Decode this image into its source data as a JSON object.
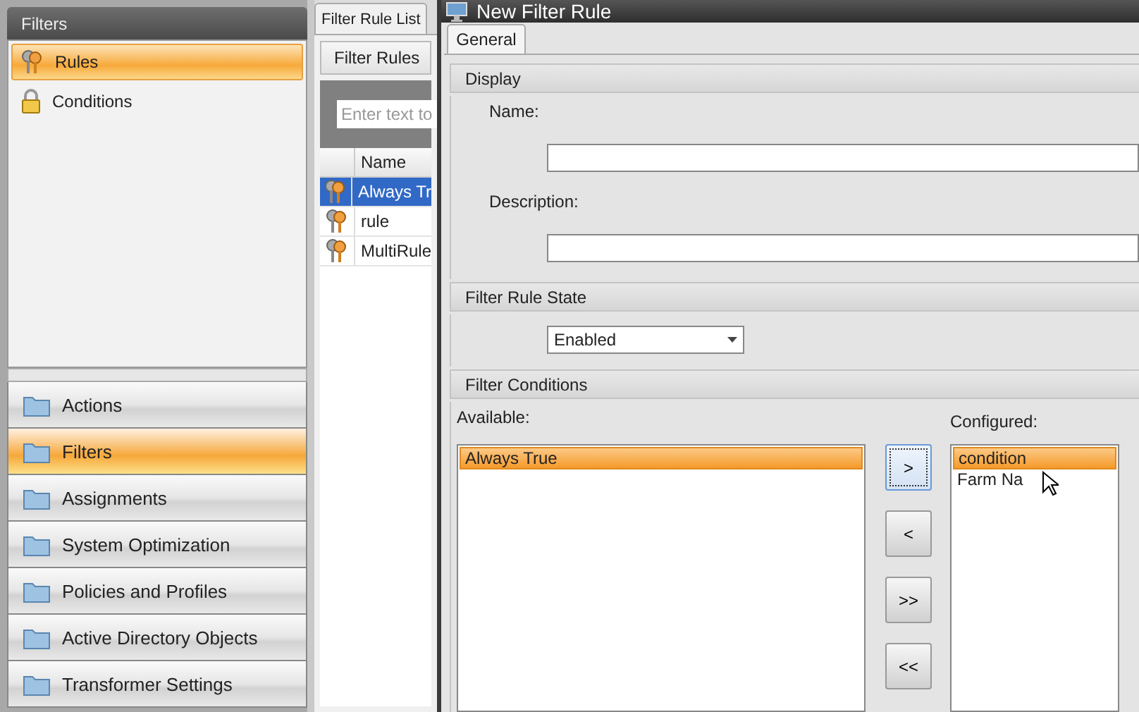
{
  "left_panel": {
    "title": "Filters",
    "items": [
      {
        "label": "Rules",
        "kind": "rule",
        "selected": true
      },
      {
        "label": "Conditions",
        "kind": "condition",
        "selected": false
      }
    ]
  },
  "navigation": [
    {
      "label": "Actions",
      "selected": false
    },
    {
      "label": "Filters",
      "selected": true
    },
    {
      "label": "Assignments",
      "selected": false
    },
    {
      "label": "System Optimization",
      "selected": false
    },
    {
      "label": "Policies and Profiles",
      "selected": false
    },
    {
      "label": "Active Directory Objects",
      "selected": false
    },
    {
      "label": "Transformer Settings",
      "selected": false
    }
  ],
  "middle": {
    "tab": "Filter Rule List",
    "subtab": "Filter Rules",
    "search": {
      "placeholder": "Enter text to"
    },
    "column": "Name",
    "rows": [
      {
        "name": "Always Tr",
        "selected": true
      },
      {
        "name": "rule",
        "selected": false
      },
      {
        "name": "MultiRule",
        "selected": false
      }
    ]
  },
  "dialog": {
    "title": "New Filter Rule",
    "tab": "General",
    "display": {
      "heading": "Display",
      "name_label": "Name:",
      "description_label": "Description:"
    },
    "state": {
      "heading": "Filter Rule State",
      "value": "Enabled"
    },
    "conditions": {
      "heading": "Filter Conditions",
      "available_label": "Available:",
      "configured_label": "Configured:",
      "available": [
        {
          "label": "Always True",
          "selected": true
        }
      ],
      "configured": [
        {
          "label": "condition",
          "selected": true
        },
        {
          "label": "Farm Na",
          "selected": false
        }
      ],
      "buttons": [
        {
          "label": ">",
          "focused": true
        },
        {
          "label": "<",
          "focused": false
        },
        {
          "label": ">>",
          "focused": false
        },
        {
          "label": "<<",
          "focused": false
        }
      ]
    }
  }
}
